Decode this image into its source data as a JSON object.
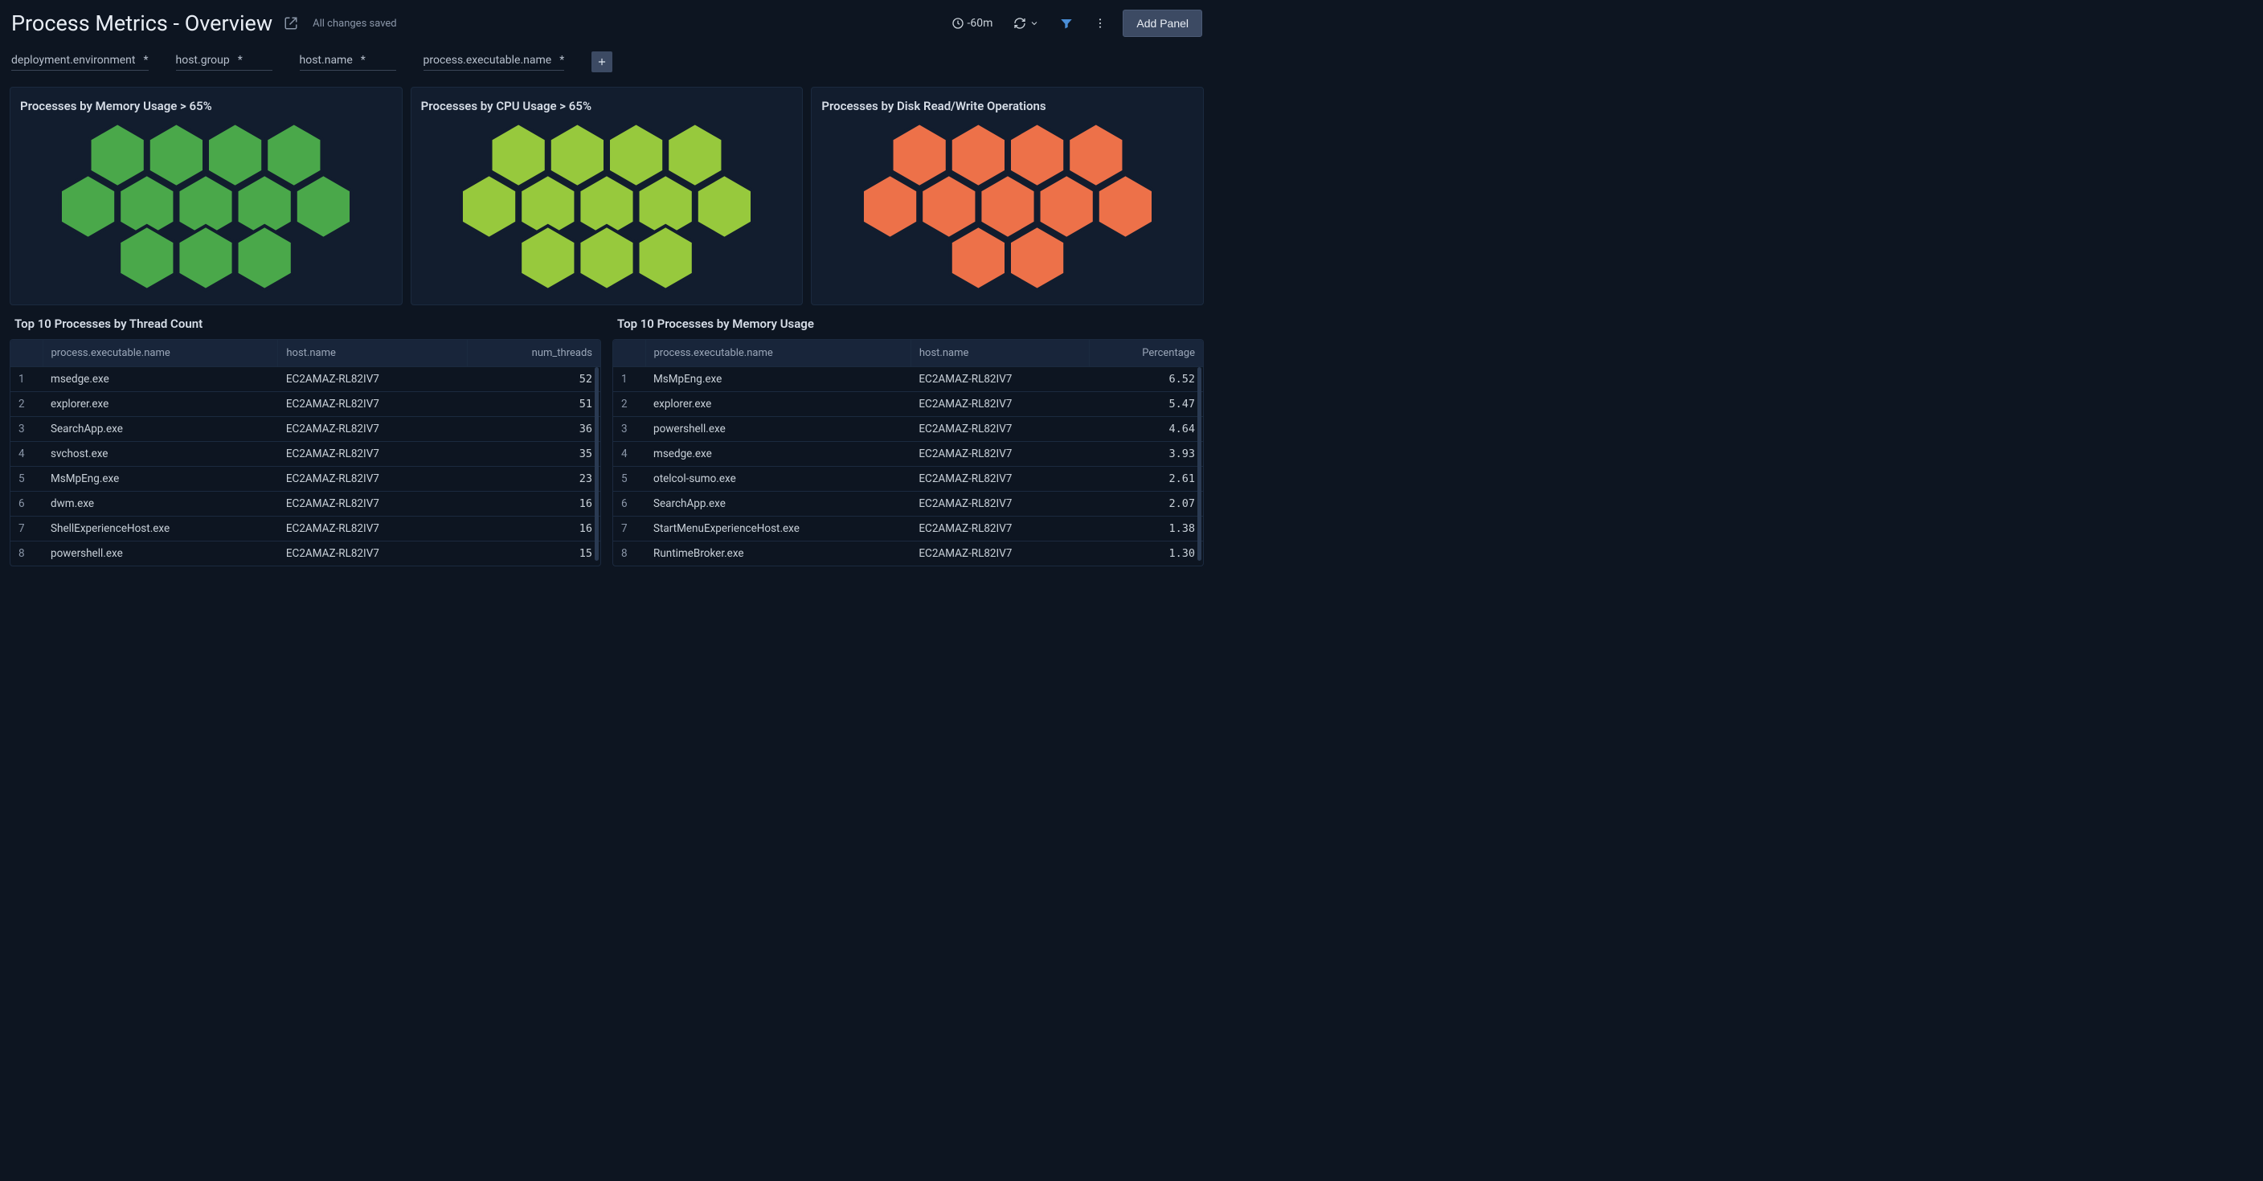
{
  "header": {
    "title": "Process Metrics - Overview",
    "save_status": "All changes saved",
    "time_range": "-60m",
    "add_panel_label": "Add Panel"
  },
  "filters": [
    {
      "label": "deployment.environment",
      "value": "*"
    },
    {
      "label": "host.group",
      "value": "*"
    },
    {
      "label": "host.name",
      "value": "*"
    },
    {
      "label": "process.executable.name",
      "value": "*"
    }
  ],
  "honeycomb_panels": [
    {
      "title": "Processes by Memory Usage > 65%",
      "color": "#4aa84a",
      "rows": [
        4,
        5,
        3
      ]
    },
    {
      "title": "Processes by CPU Usage > 65%",
      "color": "#97c93d",
      "rows": [
        4,
        5,
        3
      ]
    },
    {
      "title": "Processes by Disk Read/Write Operations",
      "color": "#ed7149",
      "rows": [
        4,
        5,
        2
      ]
    }
  ],
  "tables": {
    "threads": {
      "title": "Top 10 Processes by Thread Count",
      "columns": [
        "process.executable.name",
        "host.name",
        "num_threads"
      ],
      "rows": [
        {
          "n": 1,
          "proc": "msedge.exe",
          "host": "EC2AMAZ-RL82IV7",
          "val": "52"
        },
        {
          "n": 2,
          "proc": "explorer.exe",
          "host": "EC2AMAZ-RL82IV7",
          "val": "51"
        },
        {
          "n": 3,
          "proc": "SearchApp.exe",
          "host": "EC2AMAZ-RL82IV7",
          "val": "36"
        },
        {
          "n": 4,
          "proc": "svchost.exe",
          "host": "EC2AMAZ-RL82IV7",
          "val": "35"
        },
        {
          "n": 5,
          "proc": "MsMpEng.exe",
          "host": "EC2AMAZ-RL82IV7",
          "val": "23"
        },
        {
          "n": 6,
          "proc": "dwm.exe",
          "host": "EC2AMAZ-RL82IV7",
          "val": "16"
        },
        {
          "n": 7,
          "proc": "ShellExperienceHost.exe",
          "host": "EC2AMAZ-RL82IV7",
          "val": "16"
        },
        {
          "n": 8,
          "proc": "powershell.exe",
          "host": "EC2AMAZ-RL82IV7",
          "val": "15"
        }
      ]
    },
    "memory": {
      "title": "Top 10 Processes by Memory Usage",
      "columns": [
        "process.executable.name",
        "host.name",
        "Percentage"
      ],
      "rows": [
        {
          "n": 1,
          "proc": "MsMpEng.exe",
          "host": "EC2AMAZ-RL82IV7",
          "val": "6.52"
        },
        {
          "n": 2,
          "proc": "explorer.exe",
          "host": "EC2AMAZ-RL82IV7",
          "val": "5.47"
        },
        {
          "n": 3,
          "proc": "powershell.exe",
          "host": "EC2AMAZ-RL82IV7",
          "val": "4.64"
        },
        {
          "n": 4,
          "proc": "msedge.exe",
          "host": "EC2AMAZ-RL82IV7",
          "val": "3.93"
        },
        {
          "n": 5,
          "proc": "otelcol-sumo.exe",
          "host": "EC2AMAZ-RL82IV7",
          "val": "2.61"
        },
        {
          "n": 6,
          "proc": "SearchApp.exe",
          "host": "EC2AMAZ-RL82IV7",
          "val": "2.07"
        },
        {
          "n": 7,
          "proc": "StartMenuExperienceHost.exe",
          "host": "EC2AMAZ-RL82IV7",
          "val": "1.38"
        },
        {
          "n": 8,
          "proc": "RuntimeBroker.exe",
          "host": "EC2AMAZ-RL82IV7",
          "val": "1.30"
        }
      ]
    }
  },
  "chart_data": [
    {
      "type": "heatmap",
      "title": "Processes by Memory Usage > 65%",
      "series": [
        {
          "name": "processes",
          "values": [
            null,
            null,
            null,
            null,
            null,
            null,
            null,
            null,
            null,
            null,
            null,
            null
          ]
        }
      ],
      "note": "12 hexagonal cells all below 65% threshold (green)",
      "cell_count": 12,
      "state_color": "#4aa84a"
    },
    {
      "type": "heatmap",
      "title": "Processes by CPU Usage > 65%",
      "series": [
        {
          "name": "processes",
          "values": [
            null,
            null,
            null,
            null,
            null,
            null,
            null,
            null,
            null,
            null,
            null,
            null
          ]
        }
      ],
      "note": "12 hexagonal cells all below 65% threshold (lime)",
      "cell_count": 12,
      "state_color": "#97c93d"
    },
    {
      "type": "heatmap",
      "title": "Processes by Disk Read/Write Operations",
      "series": [
        {
          "name": "processes",
          "values": [
            null,
            null,
            null,
            null,
            null,
            null,
            null,
            null,
            null,
            null,
            null
          ]
        }
      ],
      "note": "11 hexagonal cells (orange)",
      "cell_count": 11,
      "state_color": "#ed7149"
    }
  ]
}
